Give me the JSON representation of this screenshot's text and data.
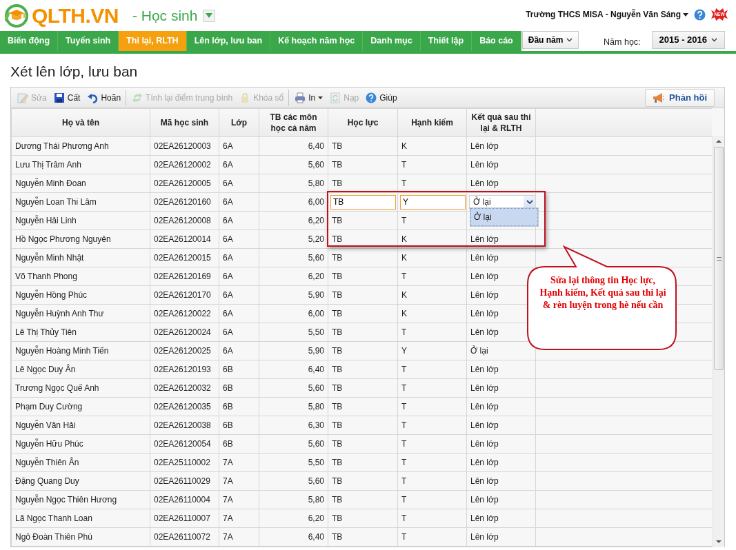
{
  "header": {
    "logo_text": "QLTH.VN",
    "module": "- Học sinh",
    "user": "Trường THCS MISA - Nguyễn Văn Sáng",
    "new_badge": "NEW"
  },
  "nav": {
    "tabs": [
      {
        "label": "Biến động",
        "selected": false
      },
      {
        "label": "Tuyển sinh",
        "selected": false
      },
      {
        "label": "Thi lại, RLTH",
        "selected": true
      },
      {
        "label": "Lên lớp, lưu ban",
        "selected": false
      },
      {
        "label": "Kế hoạch năm học",
        "selected": false
      },
      {
        "label": "Danh mục",
        "selected": false
      },
      {
        "label": "Thiết lập",
        "selected": false
      },
      {
        "label": "Báo cáo",
        "selected": false
      }
    ],
    "period_menu": "Đầu năm",
    "year_label": "Năm học:",
    "year": "2015 - 2016"
  },
  "page_title": "Xét lên lớp, lưu ban",
  "toolbar": {
    "buttons": [
      {
        "label": "Sửa",
        "disabled": true,
        "has_menu": false,
        "separator_after": false
      },
      {
        "label": "Cất",
        "disabled": false,
        "has_menu": false,
        "separator_after": false
      },
      {
        "label": "Hoãn",
        "disabled": false,
        "has_menu": false,
        "separator_after": true
      },
      {
        "label": "Tính lại điểm trung bình",
        "disabled": true,
        "has_menu": false,
        "separator_after": false
      },
      {
        "label": "Khóa sổ",
        "disabled": true,
        "has_menu": false,
        "separator_after": true
      },
      {
        "label": "In",
        "disabled": false,
        "has_menu": true,
        "separator_after": false
      },
      {
        "label": "Nạp",
        "disabled": true,
        "has_menu": false,
        "separator_after": false
      },
      {
        "label": "Giúp",
        "disabled": false,
        "has_menu": false,
        "separator_after": false
      }
    ],
    "feedback": "Phản hồi"
  },
  "table": {
    "columns": [
      {
        "label": "Họ và tên"
      },
      {
        "label": "Mã học sinh"
      },
      {
        "label": "Lớp"
      },
      {
        "label": "TB các môn học cả năm"
      },
      {
        "label": "Học lực"
      },
      {
        "label": "Hạnh kiểm"
      },
      {
        "label": "Kết quả sau thi lại & RLTH"
      }
    ],
    "rows": [
      {
        "name": "Dương Thái Phương Anh",
        "code": "02EA26120003",
        "class": "6A",
        "avg": "6,40",
        "academic": "TB",
        "conduct": "K",
        "result": "Lên lớp",
        "editing": false
      },
      {
        "name": "Lưu Thị Trâm Anh",
        "code": "02EA26120002",
        "class": "6A",
        "avg": "5,60",
        "academic": "TB",
        "conduct": "T",
        "result": "Lên lớp",
        "editing": false
      },
      {
        "name": "Nguyễn Minh Đoan",
        "code": "02EA26120005",
        "class": "6A",
        "avg": "5,80",
        "academic": "TB",
        "conduct": "T",
        "result": "Lên lớp",
        "editing": false
      },
      {
        "name": "Nguyễn Loan Thi Lâm",
        "code": "02EA26120160",
        "class": "6A",
        "avg": "6,00",
        "academic": "TB",
        "conduct": "Y",
        "result": "Ở lại",
        "editing": true
      },
      {
        "name": "Nguyễn Hải Linh",
        "code": "02EA26120008",
        "class": "6A",
        "avg": "6,20",
        "academic": "TB",
        "conduct": "T",
        "editing": false
      },
      {
        "name": "Hồ Ngọc Phương Nguyên",
        "code": "02EA26120014",
        "class": "6A",
        "avg": "5,20",
        "academic": "TB",
        "conduct": "K",
        "result": "Lên lớp",
        "editing": false
      },
      {
        "name": "Nguyễn Minh Nhật",
        "code": "02EA26120015",
        "class": "6A",
        "avg": "5,60",
        "academic": "TB",
        "conduct": "K",
        "result": "Lên lớp",
        "editing": false
      },
      {
        "name": "Võ Thanh Phong",
        "code": "02EA26120169",
        "class": "6A",
        "avg": "6,20",
        "academic": "TB",
        "conduct": "T",
        "result": "Lên lớp",
        "editing": false
      },
      {
        "name": "Nguyễn Hồng Phúc",
        "code": "02EA26120170",
        "class": "6A",
        "avg": "5,90",
        "academic": "TB",
        "conduct": "K",
        "result": "Lên lớp",
        "editing": false
      },
      {
        "name": "Nguyễn Huỳnh Anh Thư",
        "code": "02EA26120022",
        "class": "6A",
        "avg": "6,00",
        "academic": "TB",
        "conduct": "K",
        "result": "Lên lớp",
        "editing": false
      },
      {
        "name": "Lê Thị Thủy Tiên",
        "code": "02EA26120024",
        "class": "6A",
        "avg": "5,50",
        "academic": "TB",
        "conduct": "T",
        "result": "Lên lớp",
        "editing": false
      },
      {
        "name": "Nguyễn Hoàng Minh Tiến",
        "code": "02EA26120025",
        "class": "6A",
        "avg": "5,90",
        "academic": "TB",
        "conduct": "Y",
        "result": "Ở lại",
        "editing": false
      },
      {
        "name": "Lê Ngọc Duy Ân",
        "code": "02EA26120193",
        "class": "6B",
        "avg": "6,40",
        "academic": "TB",
        "conduct": "T",
        "result": "Lên lớp",
        "editing": false
      },
      {
        "name": "Trương Ngọc Quế Anh",
        "code": "02EA26120032",
        "class": "6B",
        "avg": "5,60",
        "academic": "TB",
        "conduct": "T",
        "result": "Lên lớp",
        "editing": false
      },
      {
        "name": "Phạm Duy Cường",
        "code": "02EA26120035",
        "class": "6B",
        "avg": "5,80",
        "academic": "TB",
        "conduct": "T",
        "result": "Lên lớp",
        "editing": false
      },
      {
        "name": "Nguyễn Văn Hải",
        "code": "02EA26120038",
        "class": "6B",
        "avg": "6,30",
        "academic": "TB",
        "conduct": "T",
        "result": "Lên lớp",
        "editing": false
      },
      {
        "name": "Nguyễn Hữu Phúc",
        "code": "02EA26120054",
        "class": "6B",
        "avg": "5,60",
        "academic": "TB",
        "conduct": "T",
        "result": "Lên lớp",
        "editing": false
      },
      {
        "name": "Nguyễn Thiên Ân",
        "code": "02EA25110002",
        "class": "7A",
        "avg": "5,50",
        "academic": "TB",
        "conduct": "T",
        "result": "Lên lớp",
        "editing": false
      },
      {
        "name": "Đặng Quang Duy",
        "code": "02EA26110029",
        "class": "7A",
        "avg": "5,60",
        "academic": "TB",
        "conduct": "T",
        "result": "Lên lớp",
        "editing": false
      },
      {
        "name": "Nguyễn Ngọc Thiên Hương",
        "code": "02EA26110004",
        "class": "7A",
        "avg": "5,80",
        "academic": "TB",
        "conduct": "T",
        "result": "Lên lớp",
        "editing": false
      },
      {
        "name": "Lã Ngọc Thanh Loan",
        "code": "02EA26110007",
        "class": "7A",
        "avg": "6,20",
        "academic": "TB",
        "conduct": "T",
        "result": "Lên lớp",
        "editing": false
      },
      {
        "name": "Ngô Đoàn Thiên Phú",
        "code": "02EA26110072",
        "class": "7A",
        "avg": "6,40",
        "academic": "TB",
        "conduct": "T",
        "result": "Lên lớp",
        "editing": false
      }
    ]
  },
  "dropdown": {
    "options": [
      {
        "label": "Ở lại",
        "selected": true
      }
    ]
  },
  "callout": {
    "text": "Sửa lại thông tin Học lực, Hạnh kiểm, Kết quả sau thi lại & rèn luyện trong hè nếu cần"
  }
}
